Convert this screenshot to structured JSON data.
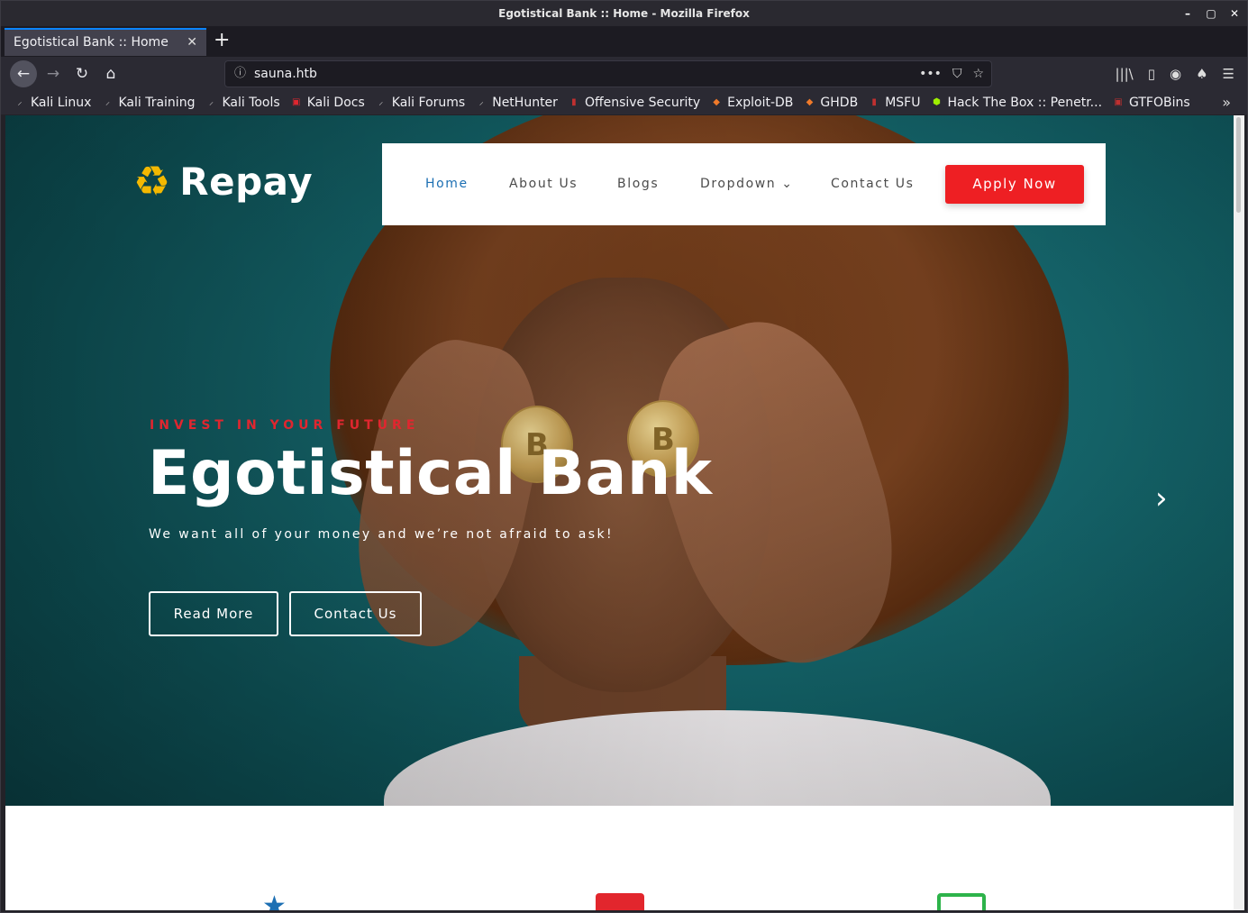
{
  "window": {
    "title": "Egotistical Bank :: Home - Mozilla Firefox",
    "controls": [
      "–",
      "▢",
      "✕"
    ]
  },
  "tab": {
    "label": "Egotistical Bank :: Home",
    "close": "✕",
    "new_tab": "+"
  },
  "navbar": {
    "back": "←",
    "forward": "→",
    "reload": "↻",
    "home": "⌂",
    "url": "sauna.htb",
    "info": "ⓘ",
    "page_actions": "•••",
    "pocket": "⛉",
    "star": "☆",
    "library": "|||\\",
    "sidebar": "▯",
    "account": "◉",
    "extension": "♠",
    "menu": "☰"
  },
  "bookmarks": [
    {
      "label": "Kali Linux",
      "icon": "dragon-icon",
      "glyph": "⸝",
      "color": "#d0d0d0"
    },
    {
      "label": "Kali Training",
      "icon": "dragon-icon",
      "glyph": "⸝",
      "color": "#d0d0d0"
    },
    {
      "label": "Kali Tools",
      "icon": "dragon-icon",
      "glyph": "⸝",
      "color": "#d0d0d0"
    },
    {
      "label": "Kali Docs",
      "icon": "docs-icon",
      "glyph": "▣",
      "color": "#e0262f"
    },
    {
      "label": "Kali Forums",
      "icon": "dragon-icon",
      "glyph": "⸝",
      "color": "#d0d0d0"
    },
    {
      "label": "NetHunter",
      "icon": "dragon-icon",
      "glyph": "⸝",
      "color": "#d0d0d0"
    },
    {
      "label": "Offensive Security",
      "icon": "offsec-icon",
      "glyph": "▮",
      "color": "#c03030"
    },
    {
      "label": "Exploit-DB",
      "icon": "exploitdb-icon",
      "glyph": "◆",
      "color": "#f07a2a"
    },
    {
      "label": "GHDB",
      "icon": "ghdb-icon",
      "glyph": "◆",
      "color": "#f07a2a"
    },
    {
      "label": "MSFU",
      "icon": "msfu-icon",
      "glyph": "▮",
      "color": "#c03030"
    },
    {
      "label": "Hack The Box :: Penetr...",
      "icon": "htb-icon",
      "glyph": "⬢",
      "color": "#9fef00"
    },
    {
      "label": "GTFOBins",
      "icon": "gtfobins-icon",
      "glyph": "▣",
      "color": "#c03030"
    }
  ],
  "bookmarks_more": "»",
  "site": {
    "logo_text": "Repay",
    "logo_glyph": "♻",
    "menu": [
      {
        "label": "Home",
        "active": true
      },
      {
        "label": "About Us",
        "active": false
      },
      {
        "label": "Blogs",
        "active": false
      },
      {
        "label": "Dropdown ⌄",
        "active": false
      },
      {
        "label": "Contact Us",
        "active": false
      }
    ],
    "apply_label": "Apply Now",
    "hero": {
      "tagline": "INVEST IN YOUR FUTURE",
      "headline": "Egotistical Bank",
      "subline": "We want all of your money and we’re not afraid to ask!",
      "read_more": "Read More",
      "contact": "Contact Us",
      "next_arrow": "›",
      "coin_glyph": "B"
    },
    "services_icons": [
      "★"
    ]
  },
  "colors": {
    "accent_red": "#ee1f23",
    "active_link": "#1c6fb3",
    "hero_teal": "#166a70",
    "logo_yellow": "#f4b800"
  }
}
